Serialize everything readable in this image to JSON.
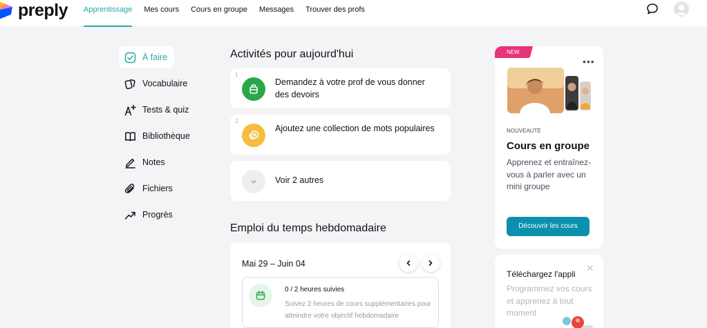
{
  "header": {
    "logo_text": "preply",
    "nav": [
      "Apprentissage",
      "Mes cours",
      "Cours en groupe",
      "Messages",
      "Trouver des profs"
    ],
    "active_nav": "Apprentissage"
  },
  "sidebar": {
    "items": [
      {
        "label": "À faire",
        "icon": "checkbox-icon"
      },
      {
        "label": "Vocabulaire",
        "icon": "cards-icon"
      },
      {
        "label": "Tests & quiz",
        "icon": "quiz-icon"
      },
      {
        "label": "Bibliothèque",
        "icon": "book-icon"
      },
      {
        "label": "Notes",
        "icon": "pen-icon"
      },
      {
        "label": "Fichiers",
        "icon": "paperclip-icon"
      },
      {
        "label": "Progrès",
        "icon": "trend-icon"
      }
    ]
  },
  "activities": {
    "title": "Activités pour aujourd'hui",
    "items": [
      {
        "num": "1",
        "text": "Demandez à votre prof de vous donner des devoirs",
        "icon": "bag-icon",
        "color": "#29a84a"
      },
      {
        "num": "2",
        "text": "Ajoutez une collection de mots populaires",
        "icon": "coins-icon",
        "color": "#f5bc3f"
      }
    ],
    "more": "Voir 2 autres"
  },
  "schedule": {
    "title": "Emploi du temps hebdomadaire",
    "range": "Mai 29 – Juin 04",
    "goal_done": "0",
    "goal_total": "/ 2 heures suivies",
    "goal_sub": "Suivez 2 heures de cours supplémentaires pour atteindre votre objectif hebdomadaire"
  },
  "promo": {
    "badge": "NEW",
    "eyebrow": "NOUVEAUTÉ",
    "title": "Cours en groupe",
    "desc": "Apprenez et entraînez-vous à parler avec un mini groupe",
    "cta": "Découvrir les cours"
  },
  "app_promo": {
    "title": "Téléchargez l'appli",
    "desc": "Programmez vos cours et apprenez à tout moment"
  },
  "colors": {
    "accent": "#2aa6a6",
    "cta": "#0c90ad",
    "badge": "#e8327a"
  }
}
